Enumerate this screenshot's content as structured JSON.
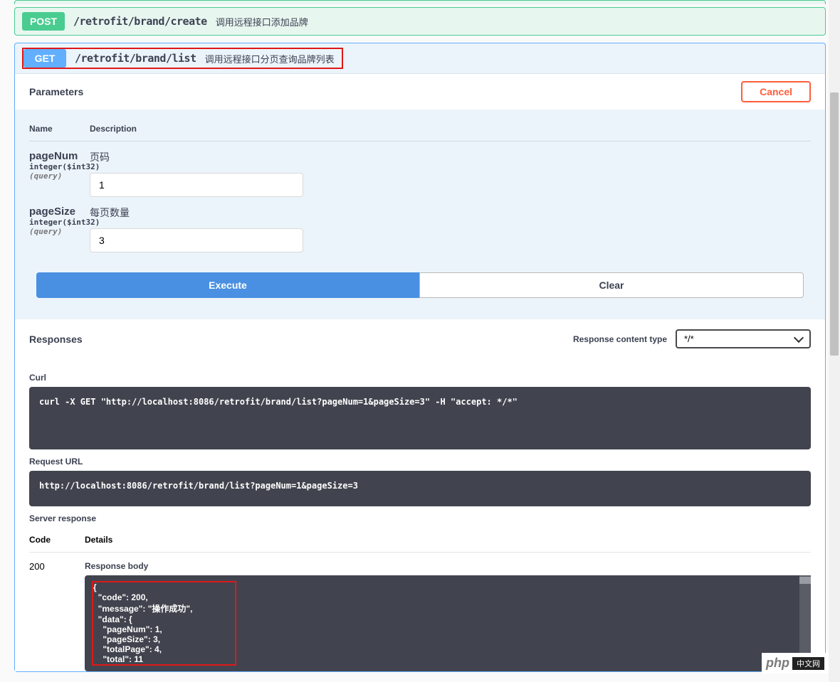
{
  "endpoints": {
    "post": {
      "method": "POST",
      "path": "/retrofit/brand/create",
      "summary": "调用远程接口添加品牌"
    },
    "get": {
      "method": "GET",
      "path": "/retrofit/brand/list",
      "summary": "调用远程接口分页查询品牌列表"
    }
  },
  "parameters": {
    "title": "Parameters",
    "cancel": "Cancel",
    "headers": {
      "name": "Name",
      "desc": "Description"
    },
    "items": [
      {
        "name": "pageNum",
        "type": "integer($int32)",
        "in": "(query)",
        "desc": "页码",
        "value": "1"
      },
      {
        "name": "pageSize",
        "type": "integer($int32)",
        "in": "(query)",
        "desc": "每页数量",
        "value": "3"
      }
    ],
    "execute": "Execute",
    "clear": "Clear"
  },
  "responses": {
    "title": "Responses",
    "contentTypeLabel": "Response content type",
    "contentType": "*/*",
    "curl": {
      "label": "Curl",
      "value": "curl -X GET \"http://localhost:8086/retrofit/brand/list?pageNum=1&pageSize=3\" -H \"accept: */*\""
    },
    "requestUrl": {
      "label": "Request URL",
      "value": "http://localhost:8086/retrofit/brand/list?pageNum=1&pageSize=3"
    },
    "serverResponse": "Server response",
    "codeHeader": "Code",
    "detailsHeader": "Details",
    "code": "200",
    "responseBodyLabel": "Response body",
    "responseBody": "{\n  \"code\": 200,\n  \"message\": \"操作成功\",\n  \"data\": {\n    \"pageNum\": 1,\n    \"pageSize\": 3,\n    \"totalPage\": 4,\n    \"total\": 11"
  },
  "watermark": {
    "left": "php",
    "right": "中文网"
  }
}
